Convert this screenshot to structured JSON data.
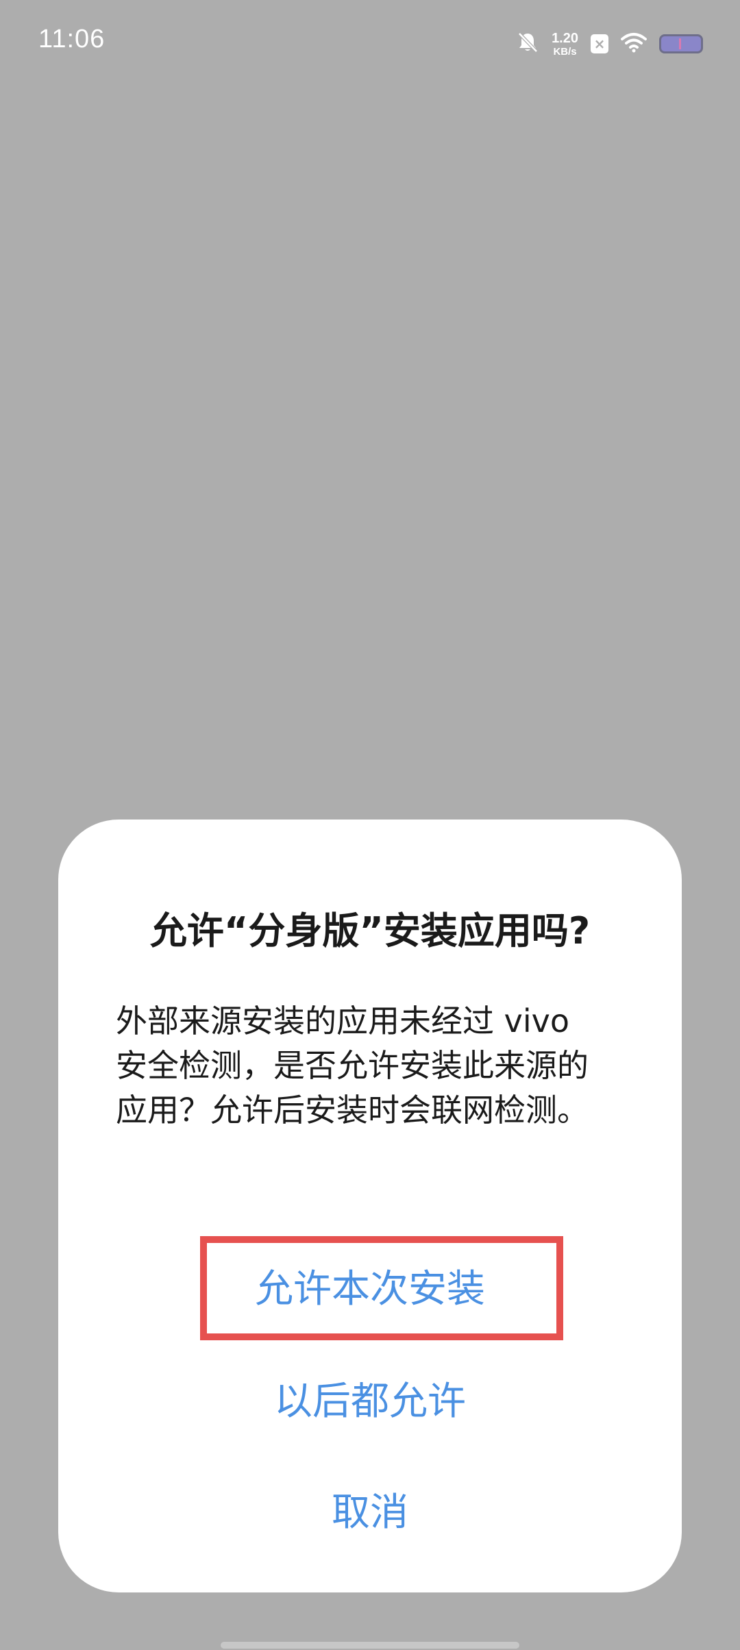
{
  "status_bar": {
    "time": "11:06",
    "net_speed_value": "1.20",
    "net_speed_unit": "KB/s",
    "sim_label": "×",
    "icons": [
      "bell-muted-icon",
      "sim-off-icon",
      "wifi-icon",
      "battery-icon"
    ]
  },
  "dialog": {
    "title": "允许“分身版”安装应用吗?",
    "message": "外部来源安装的应用未经过 vivo 安全检测，是否允许安装此来源的应用？允许后安装时会联网检测。",
    "buttons": {
      "allow_once": "允许本次安装",
      "always_allow": "以后都允许",
      "cancel": "取消"
    }
  },
  "colors": {
    "background_overlay": "#adadad",
    "dialog_bg": "#ffffff",
    "button_text": "#4a90e2",
    "highlight_border": "#e6514f"
  }
}
